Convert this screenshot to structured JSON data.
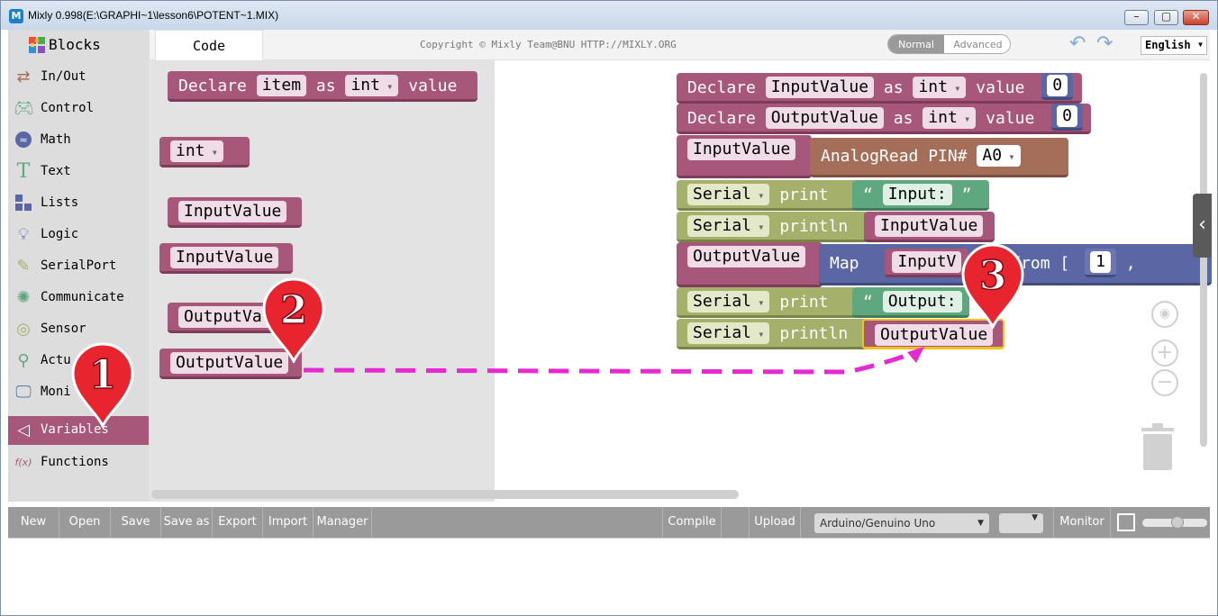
{
  "window": {
    "title": "Mixly 0.998(E:\\GRAPHI~1\\lesson6\\POTENT~1.MIX)",
    "buttons": [
      "minimize",
      "maximize",
      "close"
    ]
  },
  "tabs": {
    "blocks_label": "Blocks",
    "code_label": "Code"
  },
  "header": {
    "copyright": "Copyright © Mixly Team@BNU HTTP://MIXLY.ORG",
    "mode_normal": "Normal",
    "mode_advanced": "Advanced",
    "language": "English"
  },
  "toolbox": [
    {
      "label": "In/Out",
      "icon": "arrows-icon"
    },
    {
      "label": "Control",
      "icon": "gamepad-icon"
    },
    {
      "label": "Math",
      "icon": "math-icon"
    },
    {
      "label": "Text",
      "icon": "text-icon"
    },
    {
      "label": "Lists",
      "icon": "lists-icon"
    },
    {
      "label": "Logic",
      "icon": "bulb-icon"
    },
    {
      "label": "SerialPort",
      "icon": "pen-icon"
    },
    {
      "label": "Communicate",
      "icon": "communicate-icon"
    },
    {
      "label": "Sensor",
      "icon": "sensor-icon"
    },
    {
      "label": "Actu",
      "icon": "actuator-icon"
    },
    {
      "label": "Moni",
      "icon": "monitor-icon"
    },
    {
      "label": "Variables",
      "icon": "variables-icon",
      "selected": true
    },
    {
      "label": "Functions",
      "icon": "functions-icon"
    }
  ],
  "flyout": {
    "declare": {
      "kw": "Declare",
      "name": "item",
      "as": "as",
      "type": "int",
      "value": "value"
    },
    "type_block": "int",
    "vars": [
      "InputValue",
      "InputValue",
      "OutputValu",
      "OutputValue"
    ]
  },
  "workspace": {
    "declare1": {
      "kw": "Declare",
      "name": "InputValue",
      "as": "as",
      "type": "int",
      "value": "value",
      "init": "0"
    },
    "declare2": {
      "kw": "Declare",
      "name": "OutputValue",
      "as": "as",
      "type": "int",
      "value": "value",
      "init": "0"
    },
    "assign_input": {
      "var": "InputValue",
      "fn": "AnalogRead PIN#",
      "pin": "A0"
    },
    "print_input": {
      "obj": "Serial",
      "method": "print",
      "open_quote": "“",
      "text": "Input:",
      "close_quote": "”"
    },
    "println_input": {
      "obj": "Serial",
      "method": "println",
      "var": "InputValue"
    },
    "assign_output": {
      "var": "OutputValue",
      "fn": "Map",
      "arg": "InputV",
      "from": "from [",
      "low": "1",
      "comma": ","
    },
    "print_output": {
      "obj": "Serial",
      "method": "print",
      "open_quote": "“",
      "text": "Output:"
    },
    "println_output": {
      "obj": "Serial",
      "method": "println",
      "var": "OutputValue"
    }
  },
  "markers": [
    "1",
    "2",
    "3"
  ],
  "bottombar": {
    "buttons": [
      "New",
      "Open",
      "Save",
      "Save as",
      "Export",
      "Import",
      "Manager",
      "Compile",
      "Upload",
      "Monitor"
    ],
    "board": "Arduino/Genuino Uno",
    "slider_value": 0.55
  },
  "colors": {
    "variables": "#a6577a",
    "text": "#5fa77f",
    "serial": "#a5b06a",
    "math": "#5b67a5",
    "inout": "#a56e58",
    "marker": "#e8242f",
    "arrow": "#e52bd0"
  }
}
